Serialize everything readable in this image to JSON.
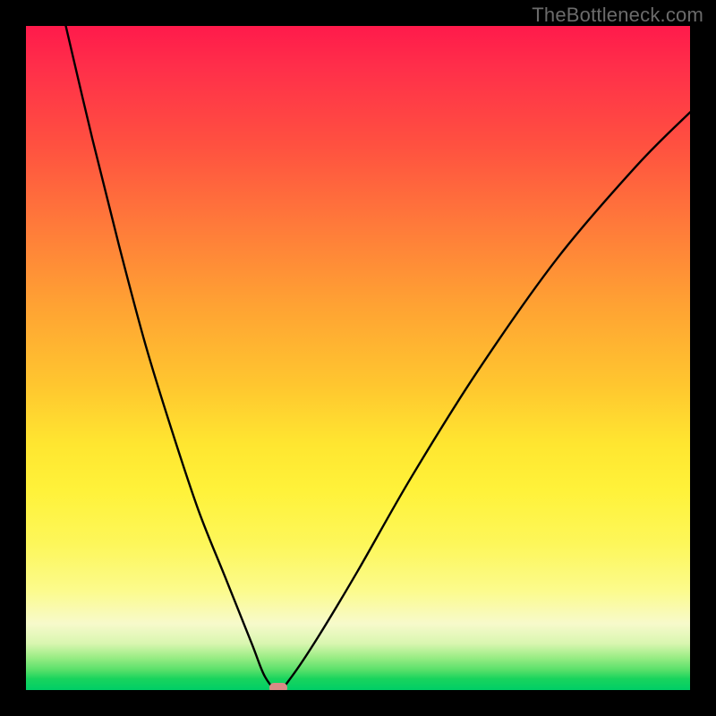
{
  "watermark": "TheBottleneck.com",
  "chart_data": {
    "type": "line",
    "title": "",
    "xlabel": "",
    "ylabel": "",
    "xlim": [
      0,
      100
    ],
    "ylim": [
      0,
      100
    ],
    "grid": false,
    "legend": false,
    "notes": "V-shaped bottleneck curve over red-to-green vertical gradient; minimum (optimal) at x≈38, y≈0; pink marker at minimum.",
    "series": [
      {
        "name": "bottleneck-curve",
        "x": [
          6,
          10,
          14,
          18,
          22,
          26,
          30,
          34,
          36,
          38,
          40,
          44,
          50,
          58,
          68,
          80,
          92,
          100
        ],
        "values": [
          100,
          83,
          67,
          52,
          39,
          27,
          17,
          7,
          2,
          0,
          2,
          8,
          18,
          32,
          48,
          65,
          79,
          87
        ]
      }
    ],
    "marker": {
      "x": 38,
      "y": 0,
      "color": "#d98b86"
    },
    "background_gradient": {
      "direction": "top-to-bottom",
      "stops": [
        [
          "#ff1a4b",
          0
        ],
        [
          "#ff7a3a",
          30
        ],
        [
          "#ffe630",
          63
        ],
        [
          "#fcfb8c",
          85
        ],
        [
          "#00ce66",
          100
        ]
      ]
    }
  }
}
